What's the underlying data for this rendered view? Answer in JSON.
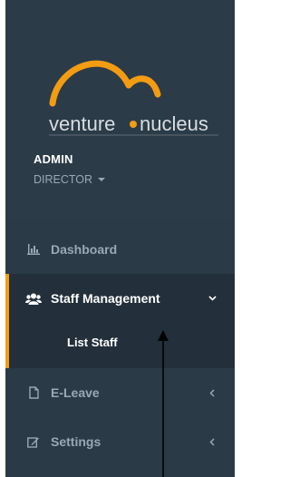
{
  "brand": {
    "logo_text_left": "venture",
    "logo_text_right": "nucleus"
  },
  "user": {
    "name": "ADMIN",
    "role": "DIRECTOR"
  },
  "nav": {
    "dashboard": "Dashboard",
    "staff_management": "Staff Management",
    "list_staff": "List Staff",
    "eleave": "E-Leave",
    "settings": "Settings"
  },
  "colors": {
    "sidebar_bg": "#2b3a47",
    "active_bg": "#23303b",
    "accent": "#f39c12",
    "muted_text": "#9aa8b5"
  },
  "icons": {
    "dashboard": "bar-chart-icon",
    "staff_management": "users-icon",
    "eleave": "file-icon",
    "settings": "edit-icon"
  }
}
